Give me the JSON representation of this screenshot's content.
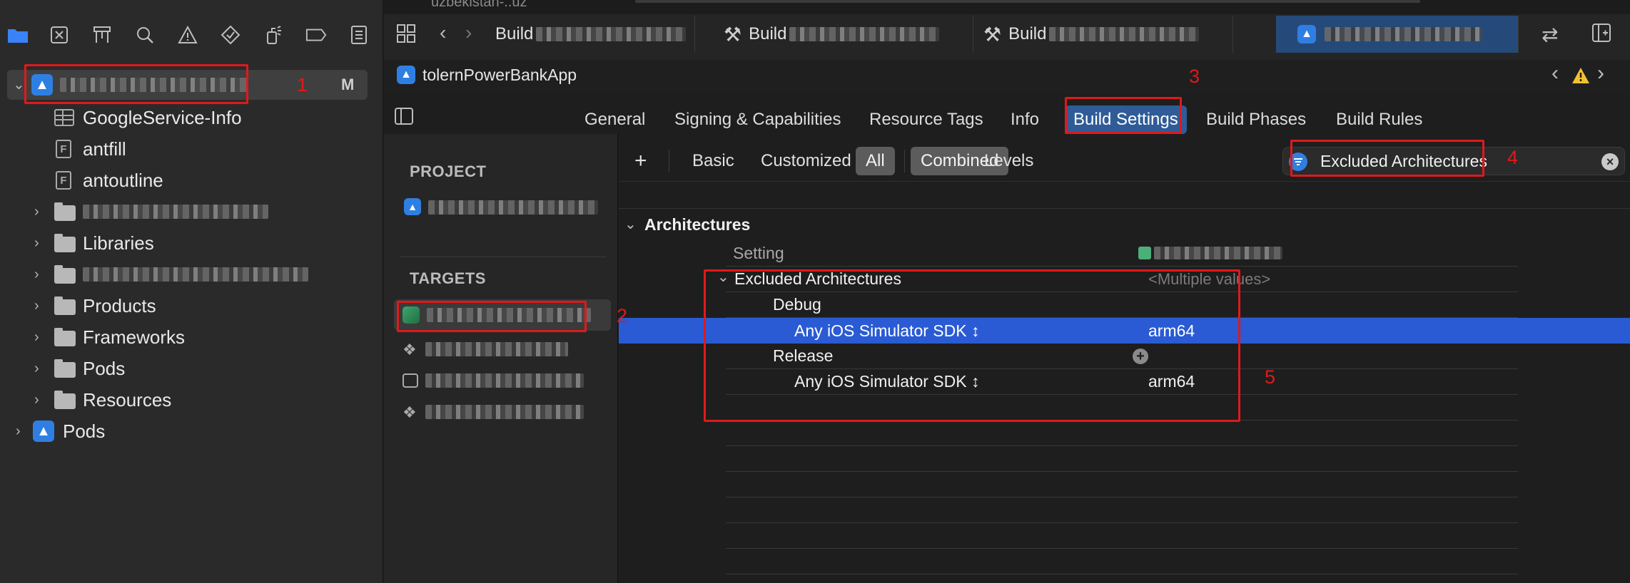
{
  "navigator": {
    "toolbar_icons": [
      "folder-icon",
      "source-control-icon",
      "symbol-hierarchy-icon",
      "search-icon",
      "warning-icon",
      "test-diamond-icon",
      "debug-spray-icon",
      "breakpoint-icon",
      "report-list-icon"
    ],
    "project_badge": "M",
    "items": [
      {
        "label": "GoogleService-Info",
        "icon": "table-icon"
      },
      {
        "label": "antfill",
        "icon": "file-icon"
      },
      {
        "label": "antoutline",
        "icon": "file-icon"
      },
      {
        "label": "",
        "icon": "folder-icon"
      },
      {
        "label": "Libraries",
        "icon": "folder-icon"
      },
      {
        "label": "",
        "icon": "folder-icon"
      },
      {
        "label": "Products",
        "icon": "folder-icon"
      },
      {
        "label": "Frameworks",
        "icon": "folder-icon"
      },
      {
        "label": "Pods",
        "icon": "folder-icon"
      },
      {
        "label": "Resources",
        "icon": "folder-icon"
      },
      {
        "label": "Pods",
        "icon": "xcode-project-icon"
      }
    ],
    "file_letter": "F"
  },
  "tabbar": {
    "top_text": "uzbekistan-..uz",
    "tab1": "Build",
    "tab2": "Build",
    "tab3": "Build"
  },
  "jumpbar": {
    "title": "tolernPowerBankApp"
  },
  "settings_tabs": [
    "General",
    "Signing & Capabilities",
    "Resource Tags",
    "Info",
    "Build Settings",
    "Build Phases",
    "Build Rules"
  ],
  "targets_pane": {
    "project_heading": "PROJECT",
    "targets_heading": "TARGETS"
  },
  "filter_bar": {
    "add": "+",
    "basic": "Basic",
    "customized": "Customized",
    "all": "All",
    "combined": "Combined",
    "levels": "Levels",
    "search_value": "Excluded Architectures"
  },
  "build_settings": {
    "section": "Architectures",
    "column_setting": "Setting",
    "excluded_label": "Excluded Architectures",
    "excluded_value": "<Multiple values>",
    "debug": "Debug",
    "release": "Release",
    "debug_sdk": "Any iOS Simulator SDK ↕",
    "debug_value": "arm64",
    "release_sdk": "Any iOS Simulator SDK ↕",
    "release_value": "arm64"
  },
  "annotations": [
    "1",
    "2",
    "3",
    "4",
    "5"
  ],
  "colors": {
    "annotation_red": "#e0191b",
    "selection_blue": "#2a5bd4",
    "accent_blue": "#3a82f7"
  }
}
